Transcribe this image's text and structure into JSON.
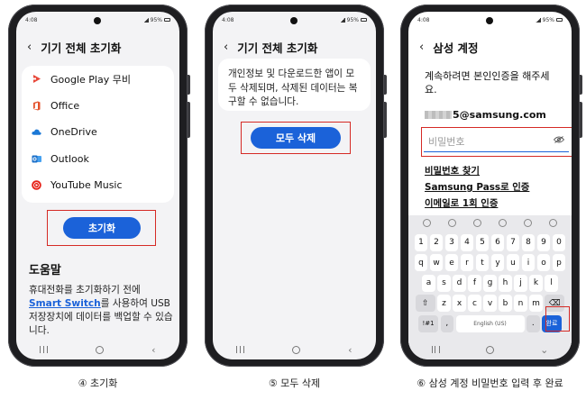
{
  "panels": [
    {
      "caption": "④ 초기화",
      "status_time": "4:08",
      "status_battery": "95%",
      "title": "기기 전체 초기화",
      "apps": [
        {
          "label": "Google Play 무비",
          "icon": "google-play-movies-icon",
          "color": "#e8483a"
        },
        {
          "label": "Office",
          "icon": "office-icon",
          "color": "#e3512b"
        },
        {
          "label": "OneDrive",
          "icon": "onedrive-icon",
          "color": "#1b78d6"
        },
        {
          "label": "Outlook",
          "icon": "outlook-icon",
          "color": "#1b70c9"
        },
        {
          "label": "YouTube Music",
          "icon": "youtube-music-icon",
          "color": "#e62117"
        }
      ],
      "action_label": "초기화",
      "help_title": "도움말",
      "help_text_1": "휴대전화를 초기화하기 전에 ",
      "help_link": "Smart Switch",
      "help_text_2": "를 사용하여 USB 저장장치에 데이터를 백업할 수 있습니다."
    },
    {
      "caption": "⑤ 모두 삭제",
      "status_time": "4:08",
      "status_battery": "95%",
      "title": "기기 전체 초기화",
      "description": "개인정보 및 다운로드한 앱이 모두 삭제되며, 삭제된 데이터는 복구할 수 없습니다.",
      "action_label": "모두 삭제"
    },
    {
      "caption": "⑥ 삼성 계정 비밀번호 입력 후 완료",
      "status_time": "4:08",
      "status_battery": "95%",
      "title": "삼성 계정",
      "prompt": "계속하려면 본인인증을 해주세요.",
      "email_suffix": "5@samsung.com",
      "password_placeholder": "비밀번호",
      "links": [
        "비밀번호 찾기",
        "Samsung Pass로 인증",
        "이메일로 1회 인증"
      ],
      "keyboard": {
        "number_row": [
          "1",
          "2",
          "3",
          "4",
          "5",
          "6",
          "7",
          "8",
          "9",
          "0"
        ],
        "row1": [
          "q",
          "w",
          "e",
          "r",
          "t",
          "y",
          "u",
          "i",
          "o",
          "p"
        ],
        "row2": [
          "a",
          "s",
          "d",
          "f",
          "g",
          "h",
          "j",
          "k",
          "l"
        ],
        "row3": [
          "z",
          "x",
          "c",
          "v",
          "b",
          "n",
          "m"
        ],
        "shift": "⇧",
        "backspace": "⌫",
        "symbols": "!#1",
        "comma": ",",
        "space": "English (US)",
        "period": ".",
        "done": "완료"
      }
    }
  ],
  "colors": {
    "accent": "#1b62d9",
    "highlight": "#d52a25"
  }
}
